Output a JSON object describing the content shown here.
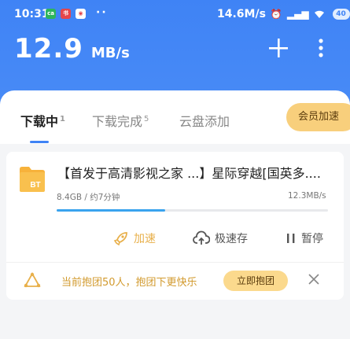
{
  "status_bar": {
    "time": "10:31",
    "net_speed": "14.6M/s",
    "battery": "40"
  },
  "header": {
    "speed_value": "12.9",
    "speed_unit": "MB/s",
    "add_icon": "plus-icon",
    "more_icon": "more-vertical-icon"
  },
  "tabs": [
    {
      "label": "下载中",
      "count": "1",
      "active": true
    },
    {
      "label": "下载完成",
      "count": "5",
      "active": false
    },
    {
      "label": "云盘添加",
      "count": "",
      "active": false
    }
  ],
  "vip_button": "会员加速",
  "download": {
    "file_type": "BT",
    "name": "【首发于高清影视之家 ...】星际穿越[国英多....",
    "size_eta": "8.4GB / 约7分钟",
    "speed": "12.3MB/s",
    "progress": 0.4,
    "actions": {
      "accelerate": "加速",
      "quick_save": "极速存",
      "pause": "暂停"
    }
  },
  "promo": {
    "text": "当前抱团50人，抱团下更快乐",
    "button": "立即抱团"
  },
  "colors": {
    "brand": "#3f83f5",
    "gold": "#f8cf7c",
    "accelerate": "#e8b04b",
    "progress": "#3aa3ee"
  }
}
